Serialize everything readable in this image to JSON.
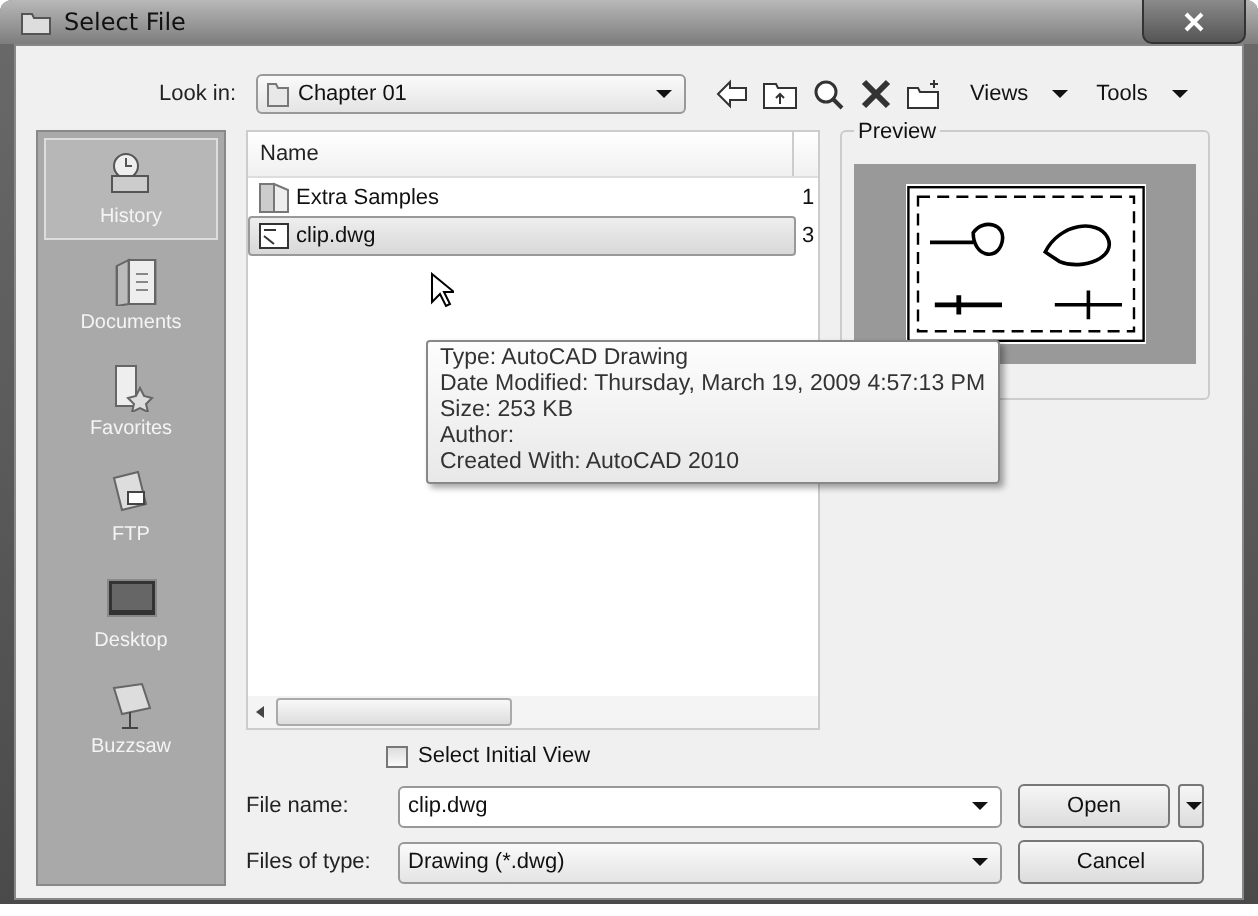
{
  "window": {
    "title": "Select File"
  },
  "look_in": {
    "label": "Look in:",
    "value": "Chapter 01"
  },
  "toolbar": {
    "views": "Views",
    "tools": "Tools"
  },
  "sidebar": {
    "items": [
      {
        "label": "History",
        "selected": true,
        "kind": "history"
      },
      {
        "label": "Documents",
        "selected": false,
        "kind": "documents"
      },
      {
        "label": "Favorites",
        "selected": false,
        "kind": "favorites"
      },
      {
        "label": "FTP",
        "selected": false,
        "kind": "ftp"
      },
      {
        "label": "Desktop",
        "selected": false,
        "kind": "desktop"
      },
      {
        "label": "Buzzsaw",
        "selected": false,
        "kind": "buzzsaw"
      }
    ]
  },
  "file_list": {
    "columns": [
      "Name"
    ],
    "rows": [
      {
        "name": "Extra Samples",
        "column_2": "1",
        "kind": "folder",
        "selected": false
      },
      {
        "name": "clip.dwg",
        "column_2": "3",
        "kind": "drawing",
        "selected": true
      }
    ]
  },
  "tooltip": [
    "Type: AutoCAD Drawing",
    "Date Modified: Thursday, March 19, 2009 4:57:13 PM",
    "Size: 253 KB",
    "Author:",
    "Created With: AutoCAD 2010"
  ],
  "preview": {
    "label": "Preview"
  },
  "select_initial_view": {
    "label": "Select Initial View",
    "checked": false
  },
  "file_name": {
    "label": "File name:",
    "value": "clip.dwg"
  },
  "files_of_type": {
    "label": "Files of type:",
    "value": "Drawing (*.dwg)"
  },
  "buttons": {
    "open": "Open",
    "cancel": "Cancel"
  }
}
